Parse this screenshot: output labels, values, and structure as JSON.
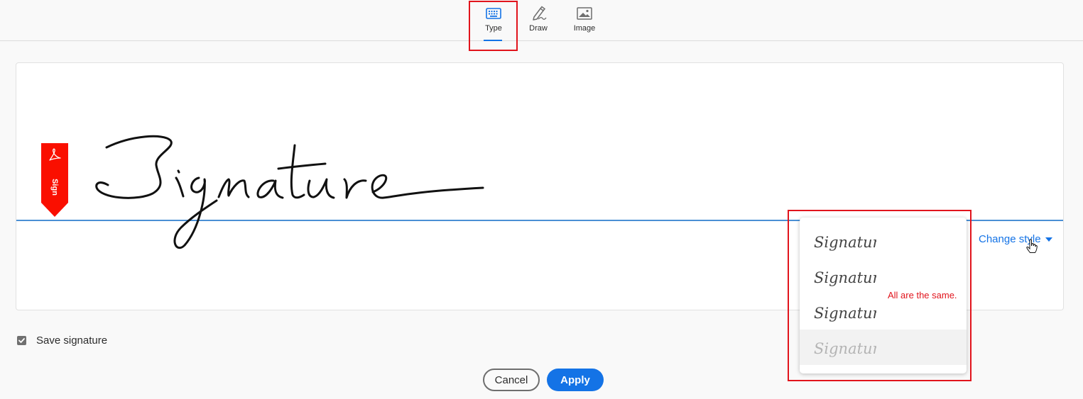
{
  "tabs": [
    {
      "label": "Type",
      "icon": "keyboard-icon",
      "active": true
    },
    {
      "label": "Draw",
      "icon": "pen-icon",
      "active": false
    },
    {
      "label": "Image",
      "icon": "image-icon",
      "active": false
    }
  ],
  "flag": {
    "label": "Sign",
    "icon": "acrobat-icon",
    "color": "#fa0f00"
  },
  "signature_text": "Signature",
  "change_style_label": "Change style",
  "style_options": [
    "Signature",
    "Signature",
    "Signature",
    "Signature"
  ],
  "annotation": "All are the same.",
  "save_signature": {
    "label": "Save signature",
    "checked": true
  },
  "buttons": {
    "cancel": "Cancel",
    "apply": "Apply"
  },
  "colors": {
    "accent": "#1473e6",
    "highlight": "#e1141c"
  }
}
